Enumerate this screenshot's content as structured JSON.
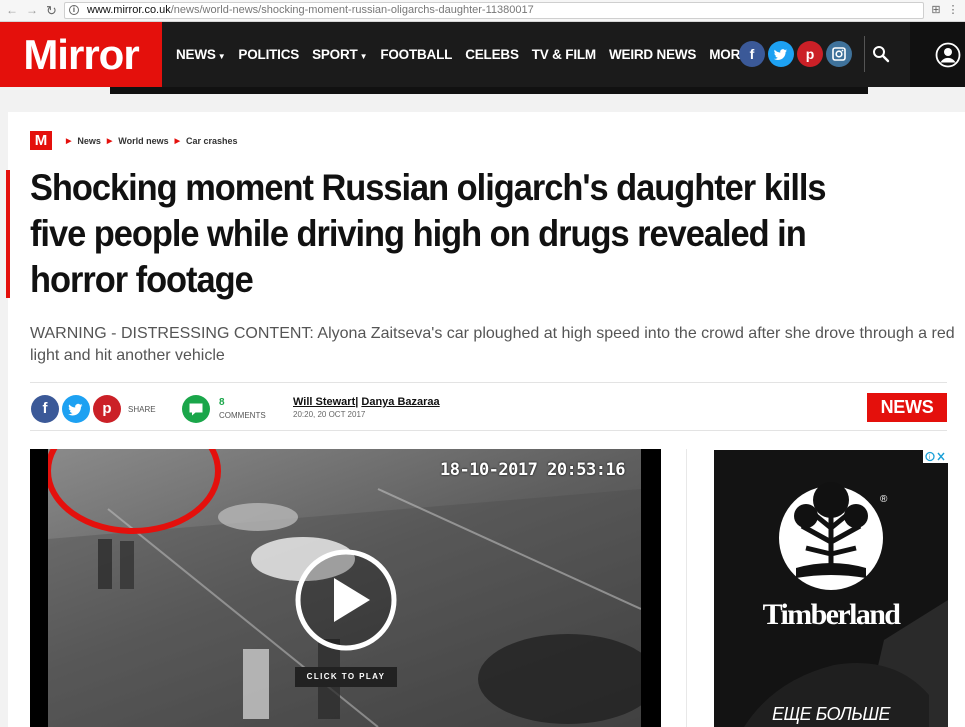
{
  "browser": {
    "url_host": "www.mirror.co.uk",
    "url_path": "/news/world-news/shocking-moment-russian-oligarchs-daughter-11380017"
  },
  "header": {
    "logo": "Mirror",
    "nav": [
      {
        "label": "NEWS",
        "dropdown": true
      },
      {
        "label": "POLITICS",
        "dropdown": false
      },
      {
        "label": "SPORT",
        "dropdown": true
      },
      {
        "label": "FOOTBALL",
        "dropdown": false
      },
      {
        "label": "CELEBS",
        "dropdown": false
      },
      {
        "label": "TV & FILM",
        "dropdown": false
      },
      {
        "label": "WEIRD NEWS",
        "dropdown": false
      },
      {
        "label": "MORE",
        "dropdown": true
      }
    ],
    "social": {
      "facebook": "f",
      "pinterest": "p"
    }
  },
  "breadcrumb": {
    "logo": "M",
    "items": [
      "News",
      "World news",
      "Car crashes"
    ]
  },
  "article": {
    "headline": "Shocking moment Russian oligarch's daughter kills five people while driving high on drugs revealed in horror footage",
    "standfirst": "WARNING - DISTRESSING CONTENT: Alyona Zaitseva's car ploughed at high speed into the crowd after she drove through a red light and hit another vehicle",
    "share_label": "SHARE",
    "comments_count": "8",
    "comments_label": "COMMENTS",
    "author1": "Will Stewart",
    "author2": "Danya Bazaraa",
    "dateline": "20:20, 20 OCT 2017",
    "badge": "NEWS"
  },
  "video": {
    "timestamp": "18-10-2017 20:53:16",
    "play_label": "CLICK TO PLAY"
  },
  "ad": {
    "brand": "Timberland",
    "registered": "®",
    "cta": "ЕЩЕ БОЛЬШЕ"
  },
  "colors": {
    "brand_red": "#e4100c",
    "header_bg": "#1b1b1b",
    "facebook": "#3b5998",
    "twitter": "#1da1f2",
    "pinterest": "#cb2027",
    "instagram": "#3f729b",
    "comments_green": "#1aa64a"
  }
}
